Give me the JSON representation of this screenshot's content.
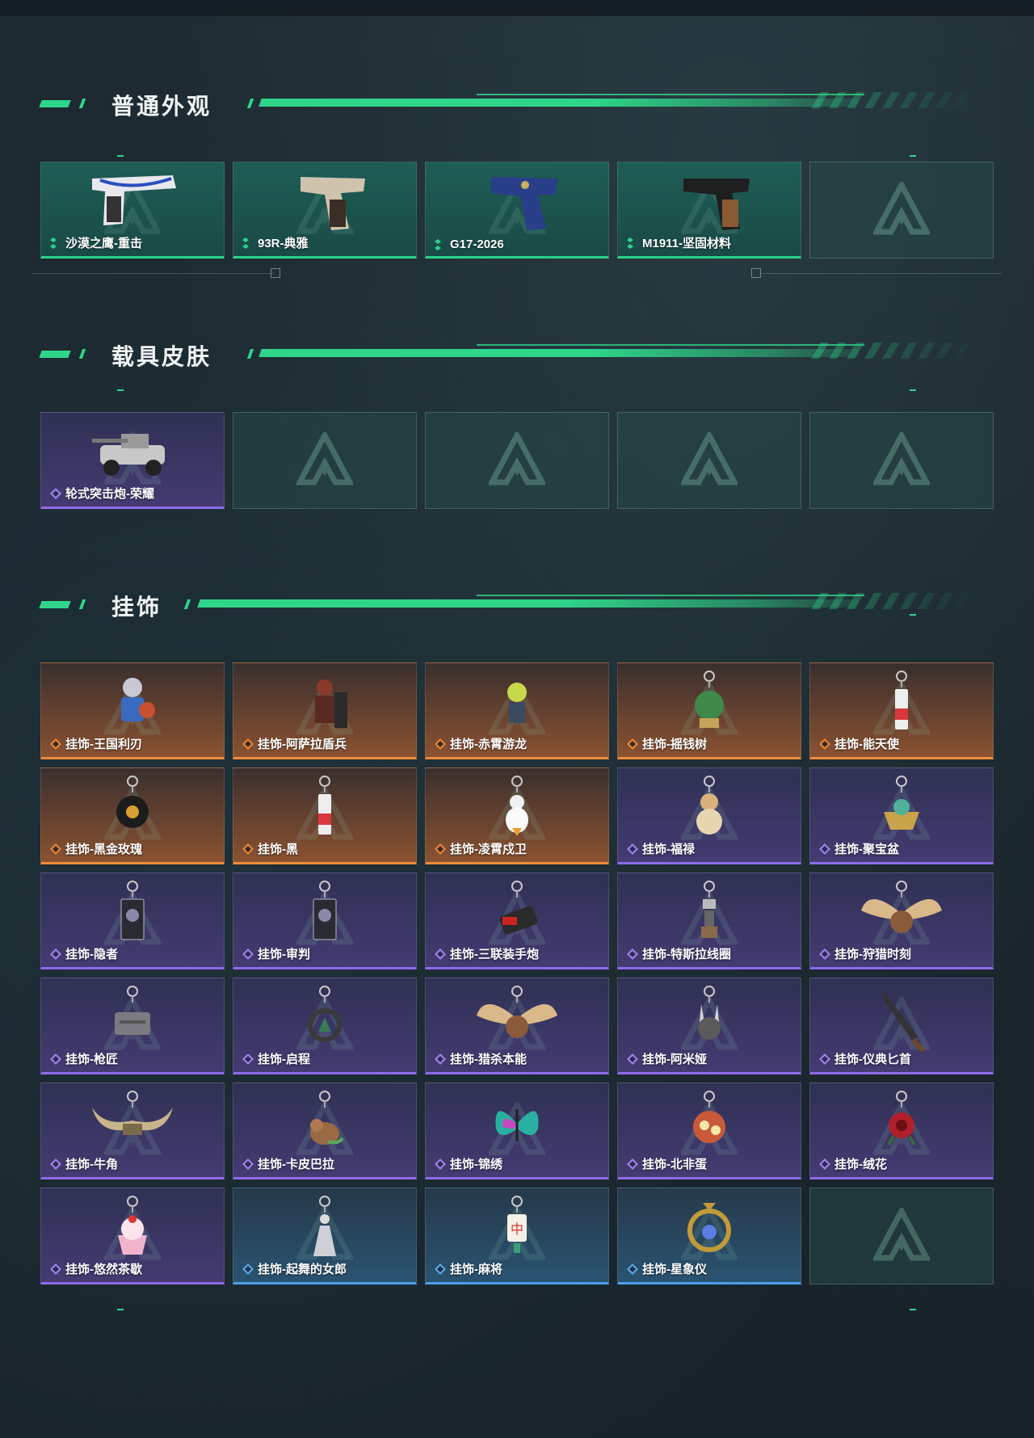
{
  "sections": [
    {
      "title": "普通外观",
      "items": [
        {
          "label": "沙漠之鹰-重击",
          "rarity": "green",
          "art": "pistol-deagle"
        },
        {
          "label": "93R-典雅",
          "rarity": "green",
          "art": "pistol-93r"
        },
        {
          "label": "G17-2026",
          "rarity": "green",
          "art": "pistol-g17"
        },
        {
          "label": "M1911-坚固材料",
          "rarity": "green",
          "art": "pistol-m1911"
        },
        {
          "label": "",
          "rarity": "empty"
        }
      ]
    },
    {
      "title": "载具皮肤",
      "items": [
        {
          "label": "轮式突击炮-荣耀",
          "rarity": "purple",
          "art": "vehicle"
        },
        {
          "label": "",
          "rarity": "empty"
        },
        {
          "label": "",
          "rarity": "empty"
        },
        {
          "label": "",
          "rarity": "empty"
        },
        {
          "label": "",
          "rarity": "empty"
        }
      ]
    },
    {
      "title": "挂饰",
      "items": [
        {
          "label": "挂饰-王国利刃",
          "rarity": "orange",
          "art": "knight"
        },
        {
          "label": "挂饰-阿萨拉盾兵",
          "rarity": "orange",
          "art": "shield-soldier"
        },
        {
          "label": "挂饰-赤霄游龙",
          "rarity": "orange",
          "art": "dragon-figure"
        },
        {
          "label": "挂饰-摇钱树",
          "rarity": "orange",
          "art": "money-tree"
        },
        {
          "label": "挂饰-能天使",
          "rarity": "orange",
          "art": "tag"
        },
        {
          "label": "挂饰-黑金玫瑰",
          "rarity": "orange",
          "art": "rose-badge"
        },
        {
          "label": "挂饰-黑",
          "rarity": "orange",
          "art": "tag"
        },
        {
          "label": "挂饰-凌霄戍卫",
          "rarity": "orange",
          "art": "duck"
        },
        {
          "label": "挂饰-福禄",
          "rarity": "purple",
          "art": "gourd"
        },
        {
          "label": "挂饰-聚宝盆",
          "rarity": "purple",
          "art": "bowl"
        },
        {
          "label": "挂饰-隐者",
          "rarity": "purple",
          "art": "card"
        },
        {
          "label": "挂饰-审判",
          "rarity": "purple",
          "art": "card"
        },
        {
          "label": "挂饰-三联装手炮",
          "rarity": "purple",
          "art": "cannon"
        },
        {
          "label": "挂饰-特斯拉线圈",
          "rarity": "purple",
          "art": "coil"
        },
        {
          "label": "挂饰-狩猎时刻",
          "rarity": "purple",
          "art": "antlers"
        },
        {
          "label": "挂饰-枪匠",
          "rarity": "purple",
          "art": "dogtag"
        },
        {
          "label": "挂饰-启程",
          "rarity": "purple",
          "art": "ring-badge"
        },
        {
          "label": "挂饰-猎杀本能",
          "rarity": "purple",
          "art": "antlers"
        },
        {
          "label": "挂饰-阿米娅",
          "rarity": "purple",
          "art": "rabbit"
        },
        {
          "label": "挂饰-仪典匕首",
          "rarity": "purple",
          "art": "dagger"
        },
        {
          "label": "挂饰-牛角",
          "rarity": "purple",
          "art": "horns"
        },
        {
          "label": "挂饰-卡皮巴拉",
          "rarity": "purple",
          "art": "capybara"
        },
        {
          "label": "挂饰-锦绣",
          "rarity": "purple",
          "art": "butterfly"
        },
        {
          "label": "挂饰-北非蛋",
          "rarity": "purple",
          "art": "egg-pan"
        },
        {
          "label": "挂饰-绒花",
          "rarity": "purple",
          "art": "flower"
        },
        {
          "label": "挂饰-悠然茶歇",
          "rarity": "purple",
          "art": "cupcake"
        },
        {
          "label": "挂饰-起舞的女郎",
          "rarity": "blue",
          "art": "dancer"
        },
        {
          "label": "挂饰-麻将",
          "rarity": "blue",
          "art": "mahjong"
        },
        {
          "label": "挂饰-星象仪",
          "rarity": "blue",
          "art": "astrolabe"
        },
        {
          "label": "",
          "rarity": "empty"
        }
      ]
    }
  ],
  "colors": {
    "accent": "#2fd68a",
    "green": "#2bd18a",
    "purple": "#8e6be8",
    "orange": "#ef8c3a",
    "blue": "#4aa0e8"
  }
}
